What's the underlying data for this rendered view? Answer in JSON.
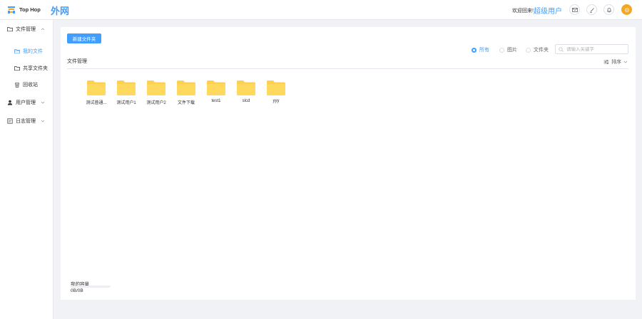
{
  "header": {
    "brand": "Top Hop",
    "network": "外网",
    "welcome": "欢迎回来!",
    "username": "超级用户",
    "logo_icon": "tophop-logo-icon",
    "actions": [
      "mail-icon",
      "edit-icon",
      "bell-icon"
    ],
    "avatar_icon": "avatar-icon"
  },
  "sidebar": {
    "items": [
      {
        "label": "文件管理",
        "icon": "folder-icon",
        "expanded": true
      },
      {
        "label": "我的文件",
        "icon": "folder-open-icon",
        "active": true
      },
      {
        "label": "共享文件夹",
        "icon": "folder-icon"
      },
      {
        "label": "回收站",
        "icon": "trash-icon"
      },
      {
        "label": "用户管理",
        "icon": "user-icon",
        "expanded": false
      },
      {
        "label": "日志管理",
        "icon": "log-icon",
        "expanded": false
      }
    ]
  },
  "toolbar": {
    "new_folder": "新建文件夹",
    "filters": [
      {
        "label": "所有",
        "checked": true
      },
      {
        "label": "图片",
        "checked": false
      },
      {
        "label": "文件夹",
        "checked": false
      }
    ],
    "search_placeholder": "请输入关键字",
    "breadcrumb": "文件管理",
    "sort": "排序"
  },
  "folders": [
    {
      "name": "测试普通..."
    },
    {
      "name": "测试用户1"
    },
    {
      "name": "测试用户2"
    },
    {
      "name": "文件下载"
    },
    {
      "name": "test1"
    },
    {
      "name": "slcd"
    },
    {
      "name": "yyy"
    }
  ],
  "quota": {
    "label": "我的容量",
    "text": "0B/0B",
    "fraction": 0
  },
  "colors": {
    "accent": "#409eff",
    "folder": "#ffd04b",
    "avatar": "#f5a623"
  }
}
